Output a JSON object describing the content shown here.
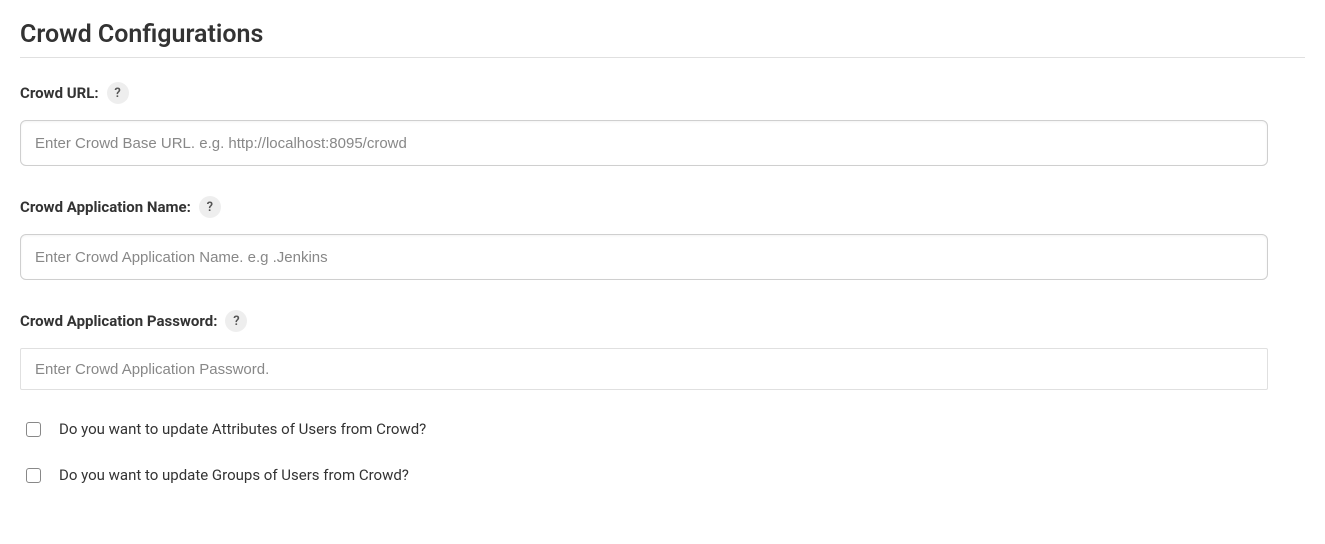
{
  "page": {
    "title": "Crowd Configurations"
  },
  "fields": {
    "crowdUrl": {
      "label": "Crowd URL:",
      "placeholder": "Enter Crowd Base URL. e.g. http://localhost:8095/crowd",
      "value": "",
      "help": "?"
    },
    "crowdAppName": {
      "label": "Crowd Application Name:",
      "placeholder": "Enter Crowd Application Name. e.g .Jenkins",
      "value": "",
      "help": "?"
    },
    "crowdAppPassword": {
      "label": "Crowd Application Password:",
      "placeholder": "Enter Crowd Application Password.",
      "value": "",
      "help": "?"
    }
  },
  "checkboxes": {
    "updateAttributes": {
      "label": "Do you want to update Attributes of Users from Crowd?",
      "checked": false
    },
    "updateGroups": {
      "label": "Do you want to update Groups of Users from Crowd?",
      "checked": false
    }
  }
}
